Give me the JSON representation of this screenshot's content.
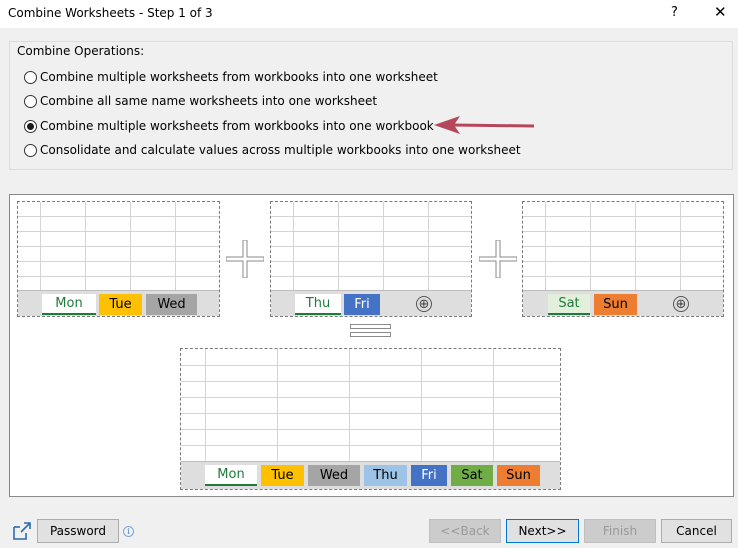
{
  "window": {
    "title": "Combine Worksheets - Step 1 of 3",
    "help_label": "?",
    "close_label": "✕"
  },
  "operations": {
    "legend": "Combine Operations:",
    "options": [
      {
        "label": "Combine multiple worksheets from workbooks into one worksheet",
        "checked": false
      },
      {
        "label": "Combine all same name worksheets into one worksheet",
        "checked": false
      },
      {
        "label": "Combine multiple worksheets from workbooks into one workbook",
        "checked": true
      },
      {
        "label": "Consolidate and calculate values across multiple workbooks into one worksheet",
        "checked": false
      }
    ]
  },
  "diagram": {
    "workbook1_tabs": [
      {
        "label": "Mon",
        "color": "#ffffff",
        "text_color": "#1f7a3c",
        "active": true
      },
      {
        "label": "Tue",
        "color": "#ffc000",
        "text_color": "#000000"
      },
      {
        "label": "Wed",
        "color": "#a5a5a5",
        "text_color": "#000000"
      }
    ],
    "workbook2_tabs": [
      {
        "label": "Thu",
        "color": "#ffffff",
        "text_color": "#1f7a3c",
        "active": true
      },
      {
        "label": "Fri",
        "color": "#4472c4",
        "text_color": "#ffffff"
      }
    ],
    "workbook3_tabs": [
      {
        "label": "Sat",
        "color": "#ffffff",
        "text_color": "#1f7a3c",
        "active": true
      },
      {
        "label": "Sun",
        "color": "#ed7d31",
        "text_color": "#000000"
      }
    ],
    "result_tabs": [
      {
        "label": "Mon",
        "color": "#ffffff",
        "text_color": "#1f7a3c",
        "active": true
      },
      {
        "label": "Tue",
        "color": "#ffc000",
        "text_color": "#000000"
      },
      {
        "label": "Wed",
        "color": "#a5a5a5",
        "text_color": "#000000"
      },
      {
        "label": "Thu",
        "color": "#9dc3e6",
        "text_color": "#000000"
      },
      {
        "label": "Fri",
        "color": "#4472c4",
        "text_color": "#ffffff"
      },
      {
        "label": "Sat",
        "color": "#70ad47",
        "text_color": "#000000"
      },
      {
        "label": "Sun",
        "color": "#ed7d31",
        "text_color": "#000000"
      }
    ],
    "add_sheet_icon": "⊕"
  },
  "footer": {
    "password_label": "Password",
    "info_label": "i",
    "back_label": "<<Back",
    "next_label": "Next>>",
    "finish_label": "Finish",
    "cancel_label": "Cancel"
  },
  "colors": {
    "arrow": "#b5475b",
    "accent_green": "#1f7a3c",
    "focus_border": "#0078d7"
  }
}
